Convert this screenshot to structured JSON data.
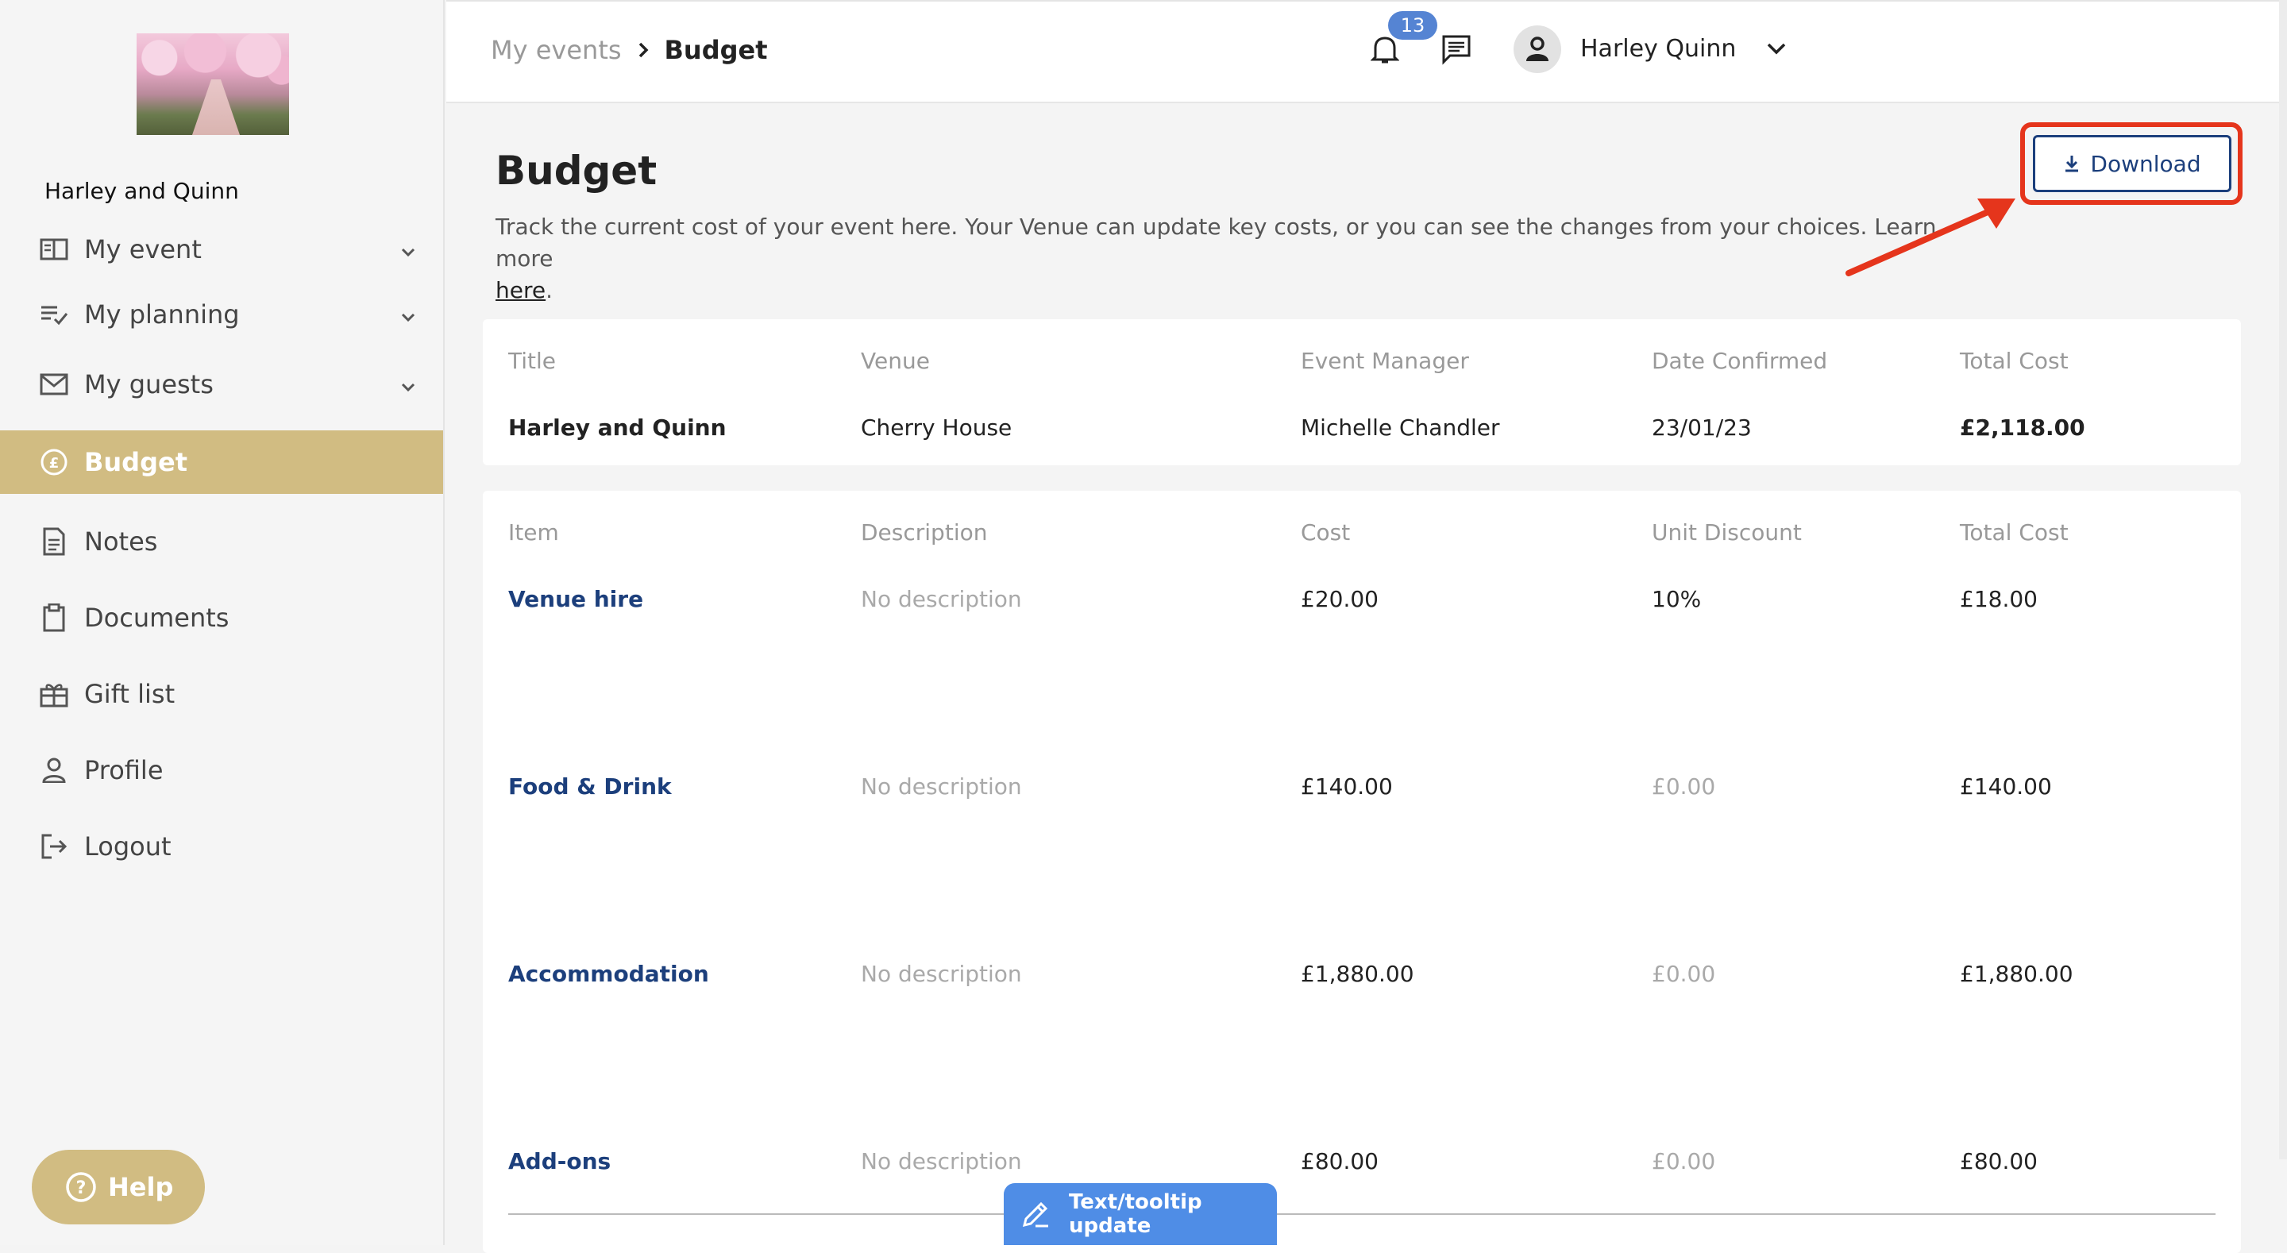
{
  "sidebar": {
    "event_name": "Harley and Quinn",
    "items": [
      {
        "label": "My event",
        "icon": "book-open-icon",
        "has_chevron": true
      },
      {
        "label": "My planning",
        "icon": "checklist-icon",
        "has_chevron": true
      },
      {
        "label": "My guests",
        "icon": "mail-icon",
        "has_chevron": true
      },
      {
        "label": "Budget",
        "icon": "pound-circle-icon",
        "active": true
      },
      {
        "label": "Notes",
        "icon": "note-icon"
      },
      {
        "label": "Documents",
        "icon": "clipboard-icon"
      },
      {
        "label": "Gift list",
        "icon": "gift-icon"
      },
      {
        "label": "Profile",
        "icon": "user-icon"
      },
      {
        "label": "Logout",
        "icon": "logout-icon"
      }
    ],
    "help_label": "Help"
  },
  "topbar": {
    "breadcrumb_parent": "My events",
    "breadcrumb_current": "Budget",
    "notification_count": "13",
    "user_name": "Harley Quinn"
  },
  "page": {
    "title": "Budget",
    "description": "Track the current cost of your event here. Your Venue can update key costs, or you can see the changes from your choices. Learn more",
    "description_link": "here",
    "download_label": "Download"
  },
  "summary": {
    "headers": [
      "Title",
      "Venue",
      "Event Manager",
      "Date Confirmed",
      "Total Cost"
    ],
    "values": [
      "Harley and Quinn",
      "Cherry House",
      "Michelle Chandler",
      "23/01/23",
      "£2,118.00"
    ]
  },
  "items": {
    "headers": [
      "Item",
      "Description",
      "Cost",
      "Unit Discount",
      "Total Cost"
    ],
    "rows": [
      {
        "item": "Venue hire",
        "description": "No description",
        "cost": "£20.00",
        "discount": "10%",
        "total": "£18.00"
      },
      {
        "item": "Food & Drink",
        "description": "No description",
        "cost": "£140.00",
        "discount": "£0.00",
        "total": "£140.00"
      },
      {
        "item": "Accommodation",
        "description": "No description",
        "cost": "£1,880.00",
        "discount": "£0.00",
        "total": "£1,880.00"
      },
      {
        "item": "Add-ons",
        "description": "No description",
        "cost": "£80.00",
        "discount": "£0.00",
        "total": "£80.00"
      }
    ]
  },
  "toast": {
    "label": "Text/tooltip update"
  },
  "colors": {
    "accent": "#d1bc82",
    "primary": "#1c3f7c",
    "badge": "#5584d3",
    "highlight": "#e5351c",
    "toast": "#4f8de6"
  }
}
